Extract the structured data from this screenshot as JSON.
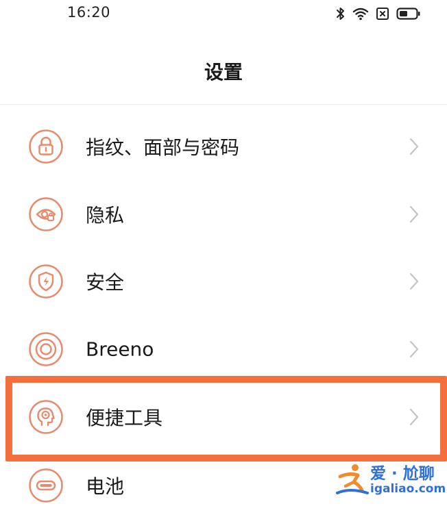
{
  "status_bar": {
    "time": "16:20",
    "icons": [
      "bluetooth-icon",
      "wifi-icon",
      "sim-none-icon",
      "battery-icon"
    ]
  },
  "header": {
    "title": "设置"
  },
  "settings": {
    "items": [
      {
        "label": "指纹、面部与密码",
        "icon": "lock-icon"
      },
      {
        "label": "隐私",
        "icon": "privacy-eye-icon"
      },
      {
        "label": "安全",
        "icon": "shield-bolt-icon"
      },
      {
        "label": "Breeno",
        "icon": "breeno-rings-icon"
      },
      {
        "label": "便捷工具",
        "icon": "convenience-tools-icon",
        "highlighted": true
      },
      {
        "label": "电池",
        "icon": "battery-item-icon"
      }
    ]
  },
  "watermark": {
    "title": "爱 · 尬聊",
    "url": "igaliao.com"
  },
  "colors": {
    "icon_accent": "#e88a6e",
    "highlight": "#f36f3c",
    "chevron": "#c4c4c4",
    "watermark": "#2f6fd6"
  }
}
